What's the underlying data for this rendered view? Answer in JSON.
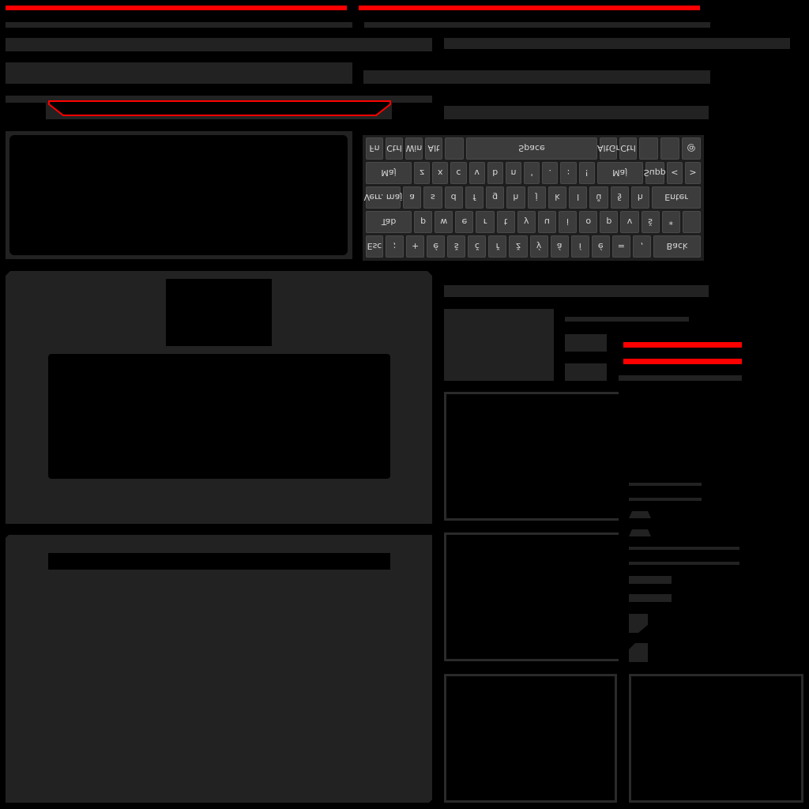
{
  "colors": {
    "panel": "#222222",
    "accent": "#ff0000",
    "background": "#000000"
  },
  "keyboard": {
    "rows": [
      [
        "Esc",
        ";",
        "+",
        "é",
        "š",
        "č",
        "ř",
        "ž",
        "ý",
        "á",
        "í",
        "é",
        "=",
        ",",
        "Back"
      ],
      [
        "Tab",
        "p",
        "w",
        "e",
        "r",
        "t",
        "y",
        "u",
        "i",
        "o",
        "p",
        "v",
        "š",
        "*",
        ""
      ],
      [
        "Verr. maj",
        "a",
        "s",
        "d",
        "f",
        "g",
        "h",
        "j",
        "k",
        "l",
        "ů",
        "§",
        "h",
        "Enter"
      ],
      [
        "Maj",
        "z",
        "x",
        "c",
        "v",
        "b",
        "n",
        "'",
        ".",
        ":",
        "!",
        "Maj",
        "Supp",
        "<",
        ">"
      ],
      [
        "Fn",
        "Ctrl",
        "Win",
        "Alt",
        "",
        "Space",
        "AltGr",
        "Ctrl",
        "",
        "",
        "@"
      ]
    ]
  }
}
